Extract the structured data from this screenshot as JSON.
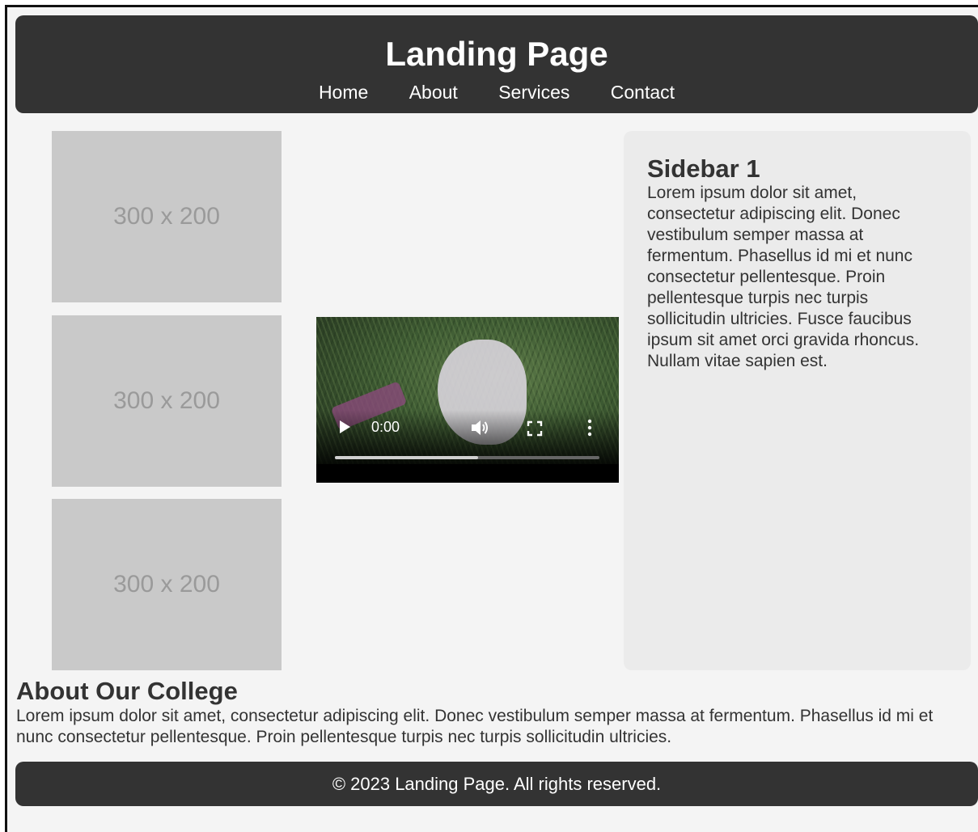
{
  "header": {
    "title": "Landing Page",
    "nav": [
      "Home",
      "About",
      "Services",
      "Contact"
    ]
  },
  "placeholders": [
    "300 x 200",
    "300 x 200",
    "300 x 200"
  ],
  "video": {
    "time": "0:00",
    "played_fraction": 0.0,
    "buffered_fraction": 0.54
  },
  "sidebar": {
    "title": "Sidebar 1",
    "text": "Lorem ipsum dolor sit amet, consectetur adipiscing elit. Donec vestibulum semper massa at fermentum. Phasellus id mi et nunc consectetur pellentesque. Proin pellentesque turpis nec turpis sollicitudin ultricies. Fusce faucibus ipsum sit amet orci gravida rhoncus. Nullam vitae sapien est."
  },
  "about": {
    "title": "About Our College",
    "text": "Lorem ipsum dolor sit amet, consectetur adipiscing elit. Donec vestibulum semper massa at fermentum. Phasellus id mi et nunc consectetur pellentesque. Proin pellentesque turpis nec turpis sollicitudin ultricies."
  },
  "footer": {
    "text": "© 2023 Landing Page. All rights reserved."
  },
  "colors": {
    "header_bg": "#333333",
    "page_bg": "#f4f4f4",
    "placeholder_bg": "#c9c9c9",
    "sidebar_bg": "#ebebeb"
  }
}
